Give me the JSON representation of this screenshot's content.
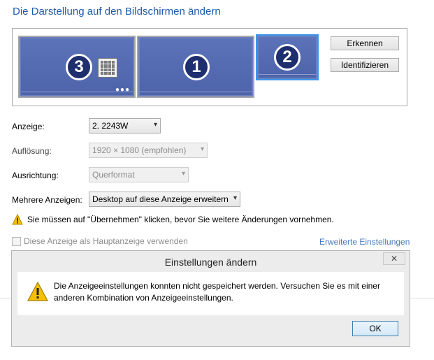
{
  "page": {
    "title": "Die Darstellung auf den Bildschirmen ändern"
  },
  "monitors": [
    {
      "number": "3"
    },
    {
      "number": "1"
    },
    {
      "number": "2"
    }
  ],
  "buttons": {
    "detect": "Erkennen",
    "identify": "Identifizieren"
  },
  "settings": {
    "display_label": "Anzeige:",
    "display_value": "2. 2243W",
    "resolution_label": "Auflösung:",
    "resolution_value": "1920 × 1080 (empfohlen)",
    "orientation_label": "Ausrichtung:",
    "orientation_value": "Querformat",
    "multiple_label": "Mehrere Anzeigen:",
    "multiple_value": "Desktop auf diese Anzeige erweitern"
  },
  "warning": {
    "text": "Sie müssen auf \"Übernehmen\" klicken, bevor Sie weitere Änderungen vornehmen."
  },
  "main_display_checkbox": "Diese Anzeige als Hauptanzeige verwenden",
  "advanced_link": "Erweiterte Einstellungen",
  "dialog": {
    "title": "Einstellungen ändern",
    "close": "✕",
    "message": "Die Anzeigeeinstellungen konnten nicht gespeichert werden. Versuchen Sie es mit einer anderen Kombination von Anzeigeeinstellungen.",
    "ok": "OK"
  },
  "colors": {
    "title": "#1e5ba8",
    "monitor": "#6a7fc0",
    "selected_border": "#3b95ea",
    "link": "#4a7ab8"
  }
}
